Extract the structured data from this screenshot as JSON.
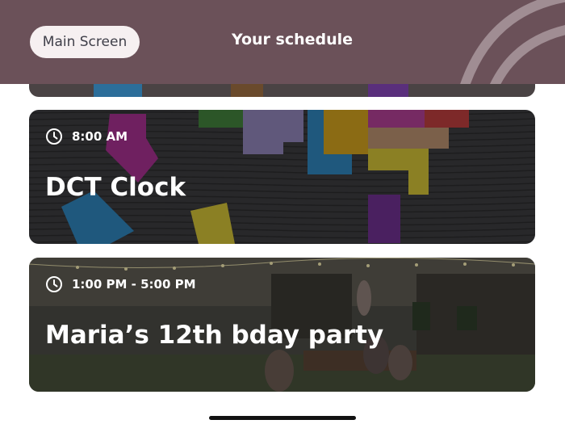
{
  "header": {
    "back_label": "Main Screen",
    "title": "Your schedule"
  },
  "events": [
    {
      "time": "8:00 AM",
      "title": "DCT Clock",
      "icon": "clock-icon"
    },
    {
      "time": "1:00 PM - 5:00 PM",
      "title": "Maria’s 12th bday party",
      "icon": "clock-icon"
    }
  ],
  "colors": {
    "header_bg": "#6b5159",
    "back_button_bg": "#f6f0f1",
    "text_light": "#ffffff"
  }
}
